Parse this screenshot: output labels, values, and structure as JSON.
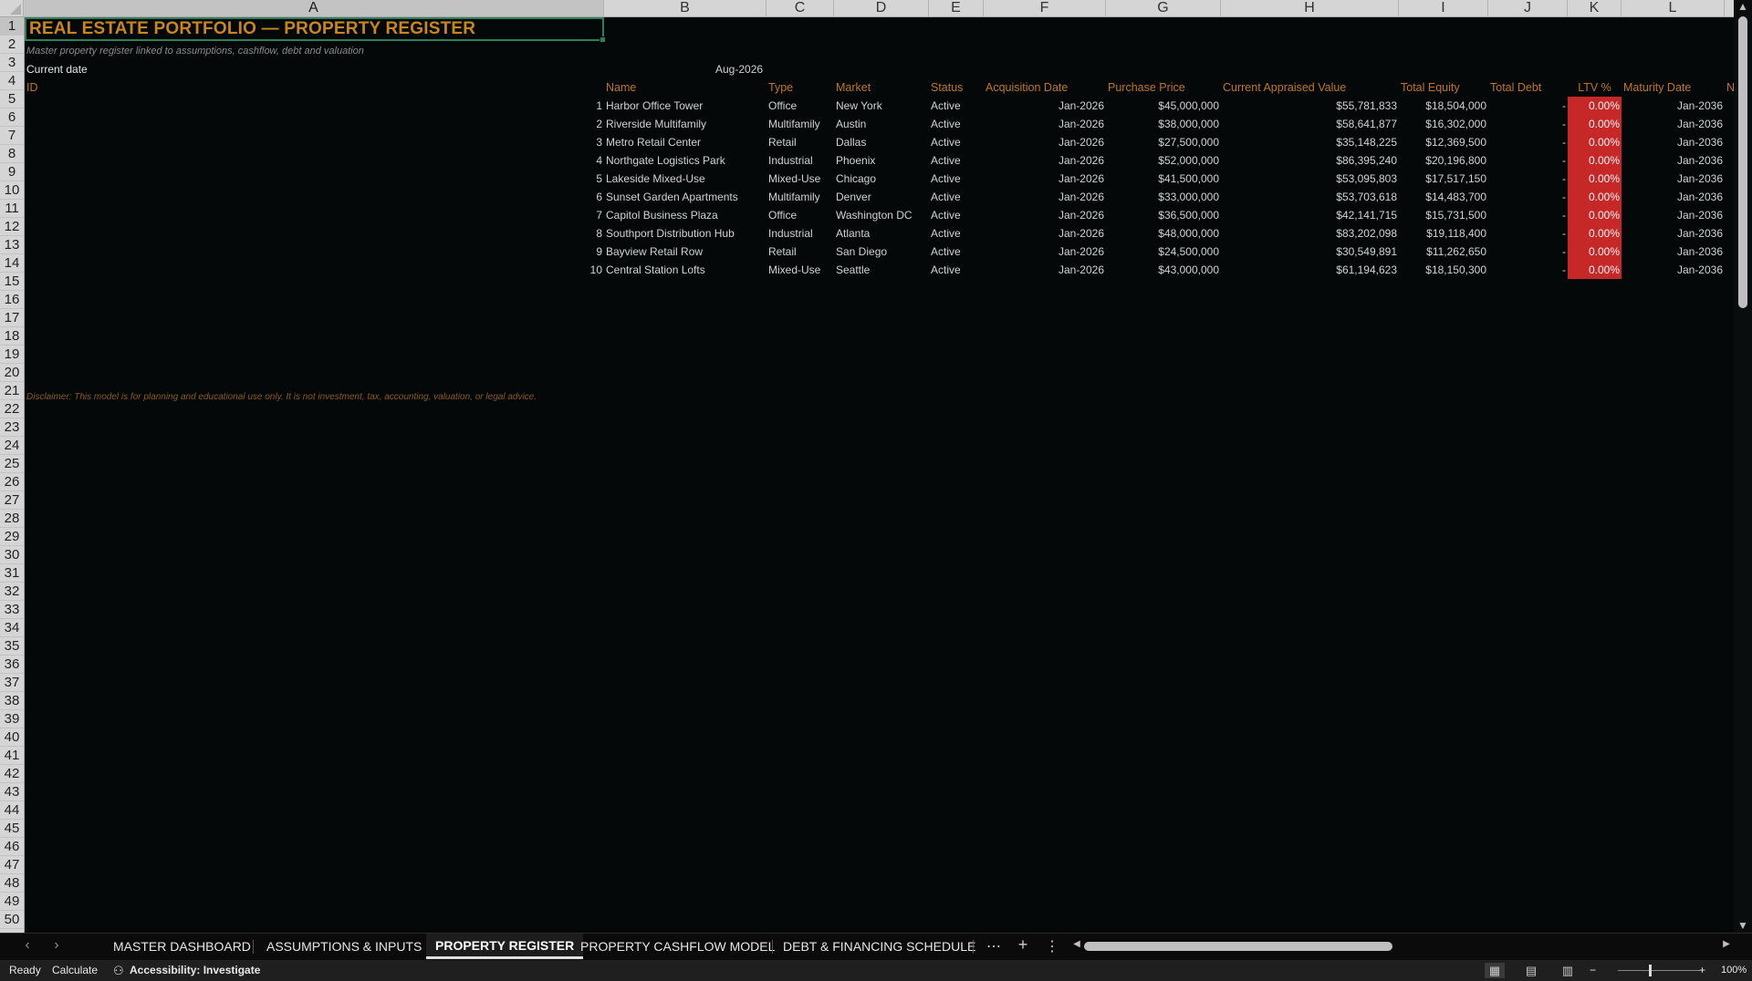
{
  "columns": [
    "A",
    "B",
    "C",
    "D",
    "E",
    "F",
    "G",
    "H",
    "I",
    "J",
    "K",
    "L"
  ],
  "rows": [
    "1",
    "2",
    "3",
    "4",
    "5",
    "6",
    "7",
    "8",
    "9",
    "10",
    "11",
    "12",
    "13",
    "14",
    "15",
    "16",
    "17",
    "18",
    "19",
    "20",
    "21",
    "22",
    "23",
    "24",
    "25",
    "26",
    "27",
    "28",
    "29",
    "30",
    "31",
    "32",
    "33",
    "34",
    "35",
    "36",
    "37",
    "38",
    "39",
    "40",
    "41",
    "42",
    "43",
    "44",
    "45",
    "46",
    "47",
    "48",
    "49",
    "50"
  ],
  "sheet": {
    "title": "REAL ESTATE PORTFOLIO — PROPERTY REGISTER",
    "subtitle": "Master property register linked to assumptions, cashflow, debt and valuation",
    "current_date_label": "Current date",
    "current_date_value": "Aug-2026",
    "disclaimer": "Disclaimer: This model is for planning and educational use only. It is not investment, tax, accounting, valuation, or legal advice.",
    "headers": [
      "ID",
      "Name",
      "Type",
      "Market",
      "Status",
      "Acquisition Date",
      "Purchase Price",
      "Current Appraised Value",
      "Total Equity",
      "Total Debt",
      "LTV %",
      "Maturity Date",
      "N"
    ]
  },
  "properties": [
    {
      "id": "1",
      "name": "Harbor Office Tower",
      "type": "Office",
      "market": "New York",
      "status": "Active",
      "acq": "Jan-2026",
      "price": "$45,000,000",
      "value": "$55,781,833",
      "equity": "$18,504,000",
      "debt": "-",
      "ltv": "0.00%",
      "maturity": "Jan-2036"
    },
    {
      "id": "2",
      "name": "Riverside Multifamily",
      "type": "Multifamily",
      "market": "Austin",
      "status": "Active",
      "acq": "Jan-2026",
      "price": "$38,000,000",
      "value": "$58,641,877",
      "equity": "$16,302,000",
      "debt": "-",
      "ltv": "0.00%",
      "maturity": "Jan-2036"
    },
    {
      "id": "3",
      "name": "Metro Retail Center",
      "type": "Retail",
      "market": "Dallas",
      "status": "Active",
      "acq": "Jan-2026",
      "price": "$27,500,000",
      "value": "$35,148,225",
      "equity": "$12,369,500",
      "debt": "-",
      "ltv": "0.00%",
      "maturity": "Jan-2036"
    },
    {
      "id": "4",
      "name": "Northgate Logistics Park",
      "type": "Industrial",
      "market": "Phoenix",
      "status": "Active",
      "acq": "Jan-2026",
      "price": "$52,000,000",
      "value": "$86,395,240",
      "equity": "$20,196,800",
      "debt": "-",
      "ltv": "0.00%",
      "maturity": "Jan-2036"
    },
    {
      "id": "5",
      "name": "Lakeside Mixed-Use",
      "type": "Mixed-Use",
      "market": "Chicago",
      "status": "Active",
      "acq": "Jan-2026",
      "price": "$41,500,000",
      "value": "$53,095,803",
      "equity": "$17,517,150",
      "debt": "-",
      "ltv": "0.00%",
      "maturity": "Jan-2036"
    },
    {
      "id": "6",
      "name": "Sunset Garden Apartments",
      "type": "Multifamily",
      "market": "Denver",
      "status": "Active",
      "acq": "Jan-2026",
      "price": "$33,000,000",
      "value": "$53,703,618",
      "equity": "$14,483,700",
      "debt": "-",
      "ltv": "0.00%",
      "maturity": "Jan-2036"
    },
    {
      "id": "7",
      "name": "Capitol Business Plaza",
      "type": "Office",
      "market": "Washington DC",
      "status": "Active",
      "acq": "Jan-2026",
      "price": "$36,500,000",
      "value": "$42,141,715",
      "equity": "$15,731,500",
      "debt": "-",
      "ltv": "0.00%",
      "maturity": "Jan-2036"
    },
    {
      "id": "8",
      "name": "Southport Distribution Hub",
      "type": "Industrial",
      "market": "Atlanta",
      "status": "Active",
      "acq": "Jan-2026",
      "price": "$48,000,000",
      "value": "$83,202,098",
      "equity": "$19,118,400",
      "debt": "-",
      "ltv": "0.00%",
      "maturity": "Jan-2036"
    },
    {
      "id": "9",
      "name": "Bayview Retail Row",
      "type": "Retail",
      "market": "San Diego",
      "status": "Active",
      "acq": "Jan-2026",
      "price": "$24,500,000",
      "value": "$30,549,891",
      "equity": "$11,262,650",
      "debt": "-",
      "ltv": "0.00%",
      "maturity": "Jan-2036"
    },
    {
      "id": "10",
      "name": "Central Station Lofts",
      "type": "Mixed-Use",
      "market": "Seattle",
      "status": "Active",
      "acq": "Jan-2026",
      "price": "$43,000,000",
      "value": "$61,194,623",
      "equity": "$18,150,300",
      "debt": "-",
      "ltv": "0.00%",
      "maturity": "Jan-2036"
    }
  ],
  "tabs": [
    "MASTER DASHBOARD",
    "ASSUMPTIONS & INPUTS",
    "PROPERTY REGISTER",
    "PROPERTY CASHFLOW MODEL",
    "DEBT & FINANCING SCHEDULE"
  ],
  "active_tab": "PROPERTY REGISTER",
  "status": {
    "ready": "Ready",
    "calculate": "Calculate",
    "accessibility": "Accessibility: Investigate",
    "zoom": "100%"
  },
  "colors": {
    "background": "#040809",
    "header_accent": "#c0761c",
    "ltv_fill": "#c62828",
    "selection_border": "#2e7d5b"
  }
}
